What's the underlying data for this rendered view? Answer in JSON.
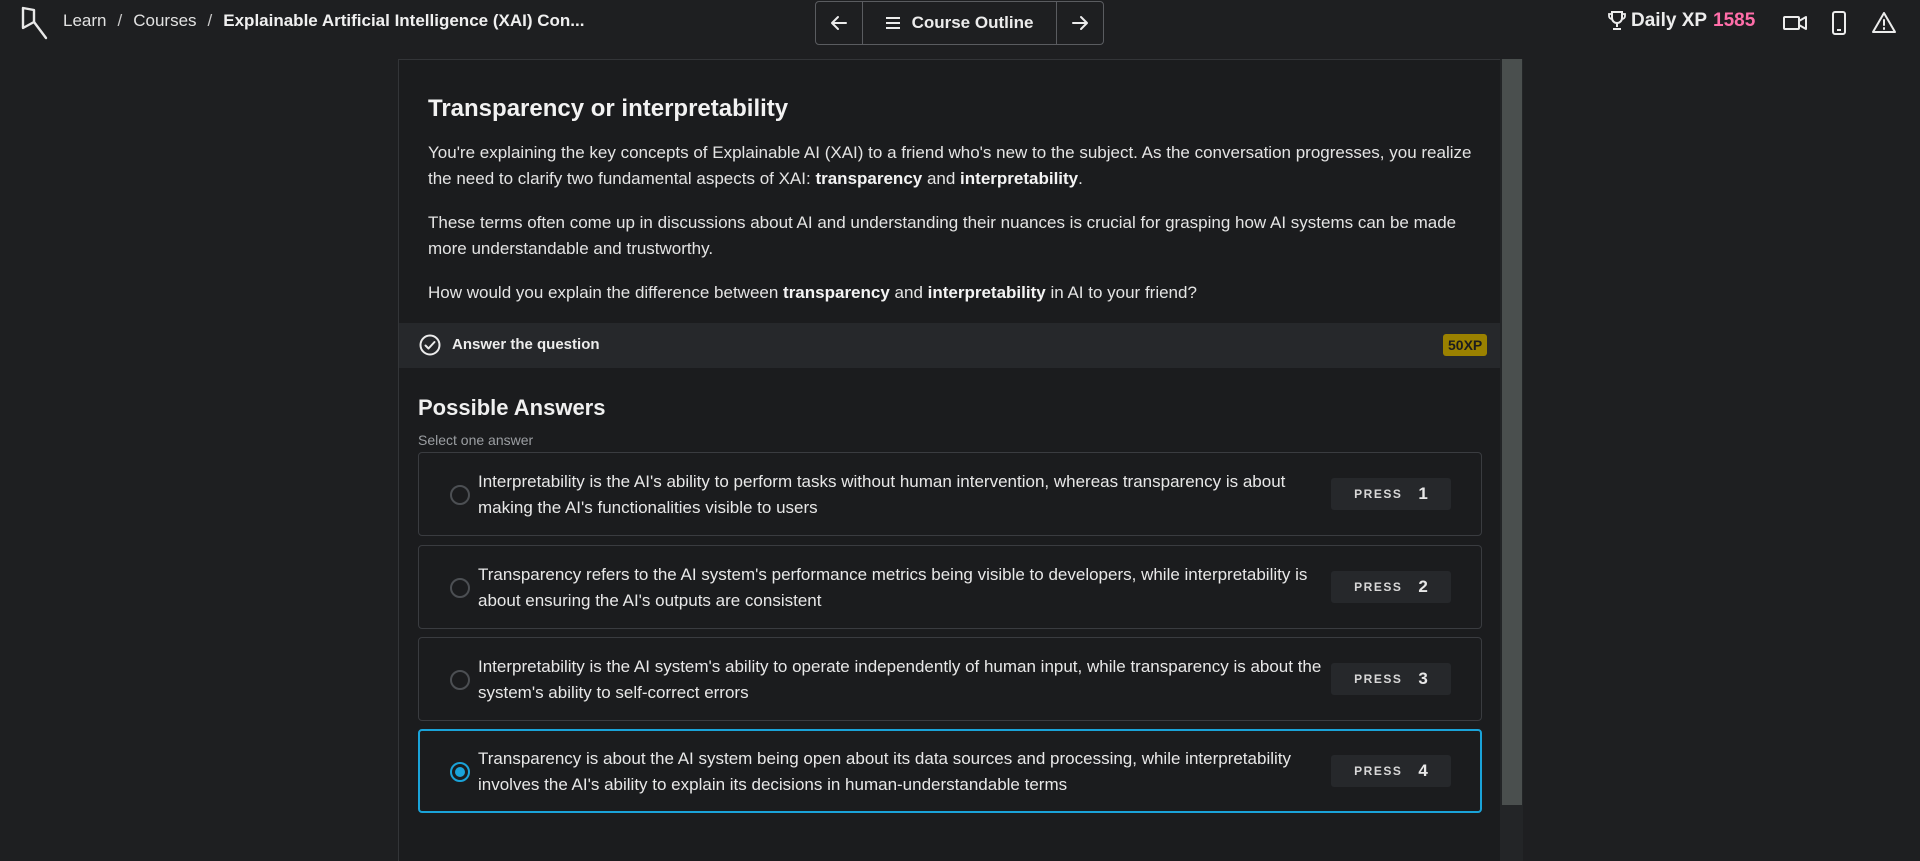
{
  "header": {
    "breadcrumb": {
      "learn": "Learn",
      "courses": "Courses",
      "current": "Explainable Artificial Intelligence (XAI) Con..."
    },
    "course_outline_label": "Course Outline",
    "daily_xp_label": "Daily XP",
    "daily_xp_value": "1585",
    "icons": [
      "logo-icon",
      "arrow-left-icon",
      "hamburger-icon",
      "arrow-right-icon",
      "trophy-icon",
      "video-icon",
      "mobile-icon",
      "alert-icon"
    ]
  },
  "exercise": {
    "title": "Transparency or interpretability",
    "para1_a": "You're explaining the key concepts of Explainable AI (XAI) to a friend who's new to the subject. As the conversation progresses, you realize the need to clarify two fundamental aspects of XAI: ",
    "para1_b1": "transparency",
    "para1_and": " and ",
    "para1_b2": "interpretability",
    "para1_end": ".",
    "para2": "These terms often come up in discussions about AI and understanding their nuances is crucial for grasping how AI systems can be made more understandable and trustworthy.",
    "para3_a": "How would you explain the difference between ",
    "para3_b1": "transparency",
    "para3_and": " and ",
    "para3_b2": "interpretability",
    "para3_end": " in AI to your friend?"
  },
  "task": {
    "label": "Answer the question",
    "xp": "50XP"
  },
  "answers_section": {
    "title": "Possible Answers",
    "subtitle": "Select one answer",
    "press_label": "PRESS",
    "options": [
      {
        "text": "Interpretability is the AI's ability to perform tasks without human intervention, whereas transparency is about making the AI's functionalities visible to users",
        "key": "1",
        "selected": false
      },
      {
        "text": "Transparency refers to the AI system's performance metrics being visible to developers, while interpretability is about ensuring the AI's outputs are consistent",
        "key": "2",
        "selected": false
      },
      {
        "text": "Interpretability is the AI system's ability to operate independently of human input, while transparency is about the system's ability to self-correct errors",
        "key": "3",
        "selected": false
      },
      {
        "text": "Transparency is about the AI system being open about its data sources and processing, while interpretability involves the AI's ability to explain its decisions in human-understandable terms",
        "key": "4",
        "selected": true
      }
    ]
  },
  "colors": {
    "background": "#1e1f21",
    "accent_blue": "#1aa3d9",
    "xp_pink": "#ff6ea9",
    "xp_badge": "#9a8100"
  }
}
